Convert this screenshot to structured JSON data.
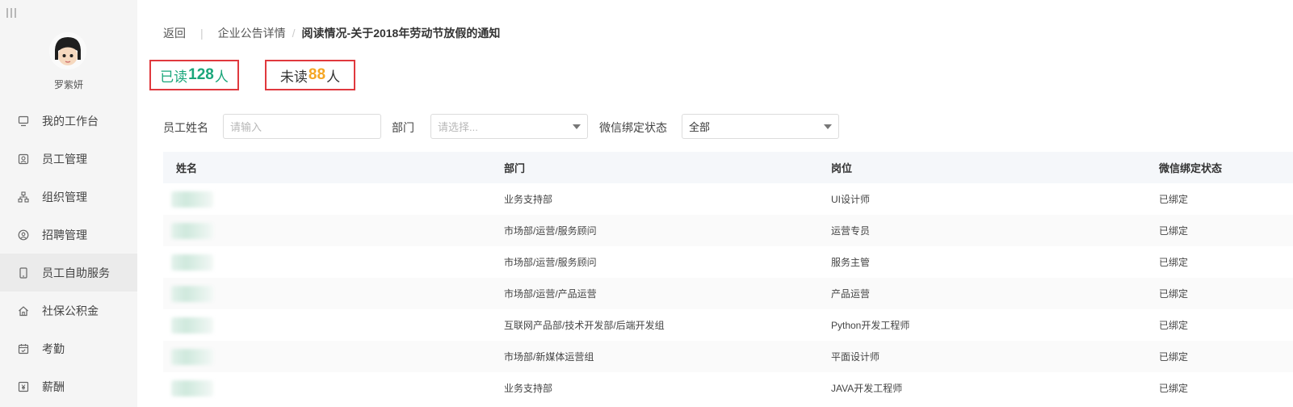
{
  "sidebar": {
    "user_name": "罗紫妍",
    "items": [
      {
        "label": "我的工作台",
        "icon": "monitor-icon"
      },
      {
        "label": "员工管理",
        "icon": "id-card-icon"
      },
      {
        "label": "组织管理",
        "icon": "org-chart-icon"
      },
      {
        "label": "招聘管理",
        "icon": "recruit-icon"
      },
      {
        "label": "员工自助服务",
        "icon": "mobile-icon"
      },
      {
        "label": "社保公积金",
        "icon": "house-icon"
      },
      {
        "label": "考勤",
        "icon": "calendar-icon"
      },
      {
        "label": "薪酬",
        "icon": "salary-icon"
      }
    ],
    "active_index": 4
  },
  "breadcrumb": {
    "back": "返回",
    "parent": "企业公告详情",
    "current": "阅读情况-关于2018年劳动节放假的通知"
  },
  "stats": {
    "read_prefix": "已读",
    "read_count": "128",
    "read_suffix": "人",
    "unread_prefix": "未读",
    "unread_count": "88",
    "unread_suffix": "人"
  },
  "filters": {
    "name_label": "员工姓名",
    "name_placeholder": "请输入",
    "dept_label": "部门",
    "dept_placeholder": "请选择...",
    "wechat_label": "微信绑定状态",
    "wechat_value": "全部"
  },
  "table": {
    "columns": [
      "姓名",
      "部门",
      "岗位",
      "微信绑定状态"
    ],
    "rows": [
      {
        "department": "业务支持部",
        "position": "UI设计师",
        "status": "已绑定"
      },
      {
        "department": "市场部/运营/服务顾问",
        "position": "运营专员",
        "status": "已绑定"
      },
      {
        "department": "市场部/运营/服务顾问",
        "position": "服务主管",
        "status": "已绑定"
      },
      {
        "department": "市场部/运营/产品运营",
        "position": "产品运营",
        "status": "已绑定"
      },
      {
        "department": "互联网产品部/技术开发部/后端开发组",
        "position": "Python开发工程师",
        "status": "已绑定"
      },
      {
        "department": "市场部/新媒体运营组",
        "position": "平面设计师",
        "status": "已绑定"
      },
      {
        "department": "业务支持部",
        "position": "JAVA开发工程师",
        "status": "已绑定"
      }
    ]
  },
  "colors": {
    "read": "#1aa67a",
    "unread_count": "#f5a623",
    "highlight_box": "#e0393e"
  }
}
